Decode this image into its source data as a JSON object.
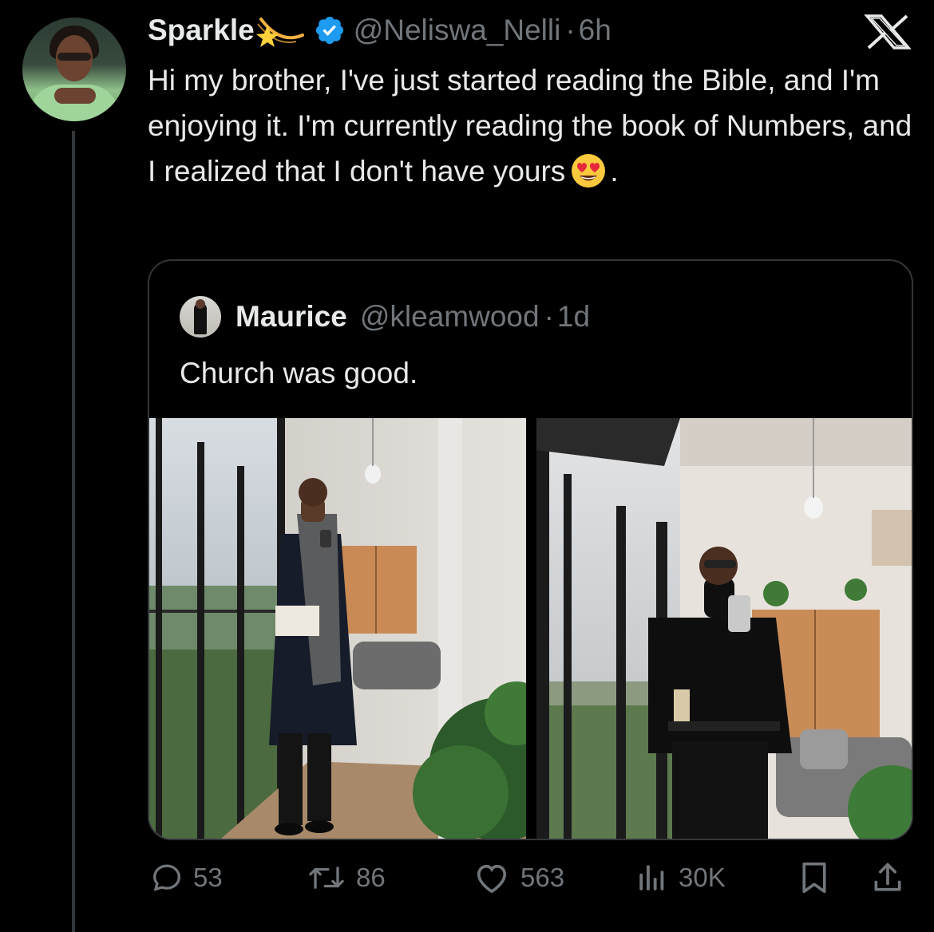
{
  "author": {
    "name": "Sparkle",
    "name_emoji": "shooting-star",
    "verified": true,
    "handle": "@Neliswa_Nelli",
    "separator": "·",
    "time": "6h"
  },
  "tweet": {
    "text": "Hi my brother, I've just started reading the Bible, and I'm enjoying it. I'm currently reading the book of Numbers, and I realized that I don't have yours",
    "emoji": "smiling-face-with-heart-eyes",
    "text_end": "."
  },
  "quote": {
    "name": "Maurice",
    "handle": "@kleamwood",
    "separator": "·",
    "time": "1d",
    "text": "Church was good.",
    "photos": [
      "man-in-coat-mirror-selfie",
      "man-in-turtleneck-mirror-selfie"
    ]
  },
  "actions": {
    "replies": "53",
    "retweets": "86",
    "likes": "563",
    "views": "30K"
  },
  "colors": {
    "background": "#000000",
    "text": "#e7e9ea",
    "muted": "#71767b",
    "border": "#333639",
    "verified": "#1d9bf0"
  }
}
